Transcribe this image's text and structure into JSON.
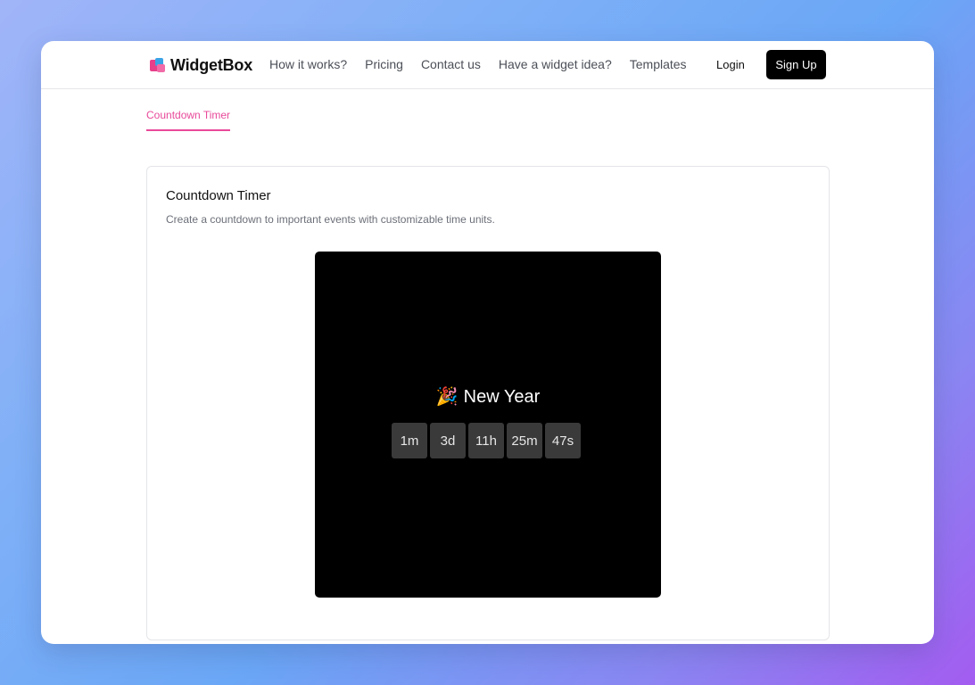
{
  "brand": {
    "name": "WidgetBox"
  },
  "nav": {
    "links": [
      "How it works?",
      "Pricing",
      "Contact us",
      "Have a widget idea?",
      "Templates"
    ],
    "login": "Login",
    "signup": "Sign Up"
  },
  "tab": {
    "label": "Countdown Timer"
  },
  "card": {
    "title": "Countdown Timer",
    "description": "Create a countdown to important events with customizable time units."
  },
  "preview": {
    "emoji": "🎉",
    "event_title": "New Year",
    "units": [
      "1m",
      "3d",
      "11h",
      "25m",
      "47s"
    ]
  },
  "colors": {
    "accent": "#e8499a",
    "button": "#000000",
    "unit_bg": "#3a3a3a"
  }
}
